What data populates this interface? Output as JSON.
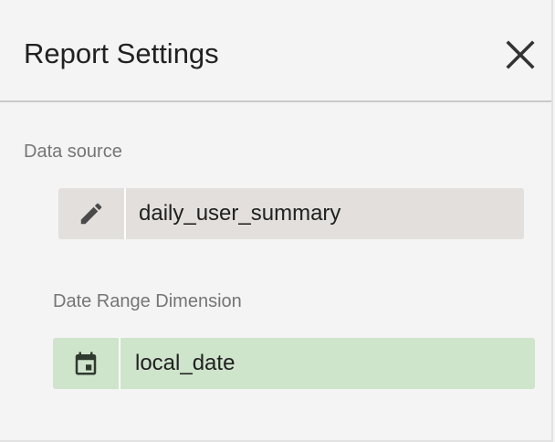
{
  "panel": {
    "title": "Report Settings",
    "close_icon": "close-icon"
  },
  "data_source": {
    "label": "Data source",
    "value": "daily_user_summary",
    "icon": "pencil-icon",
    "chip_color": "#e2dfdc"
  },
  "date_range": {
    "label": "Date Range Dimension",
    "value": "local_date",
    "icon": "calendar-icon",
    "chip_color": "#cee4cb"
  }
}
